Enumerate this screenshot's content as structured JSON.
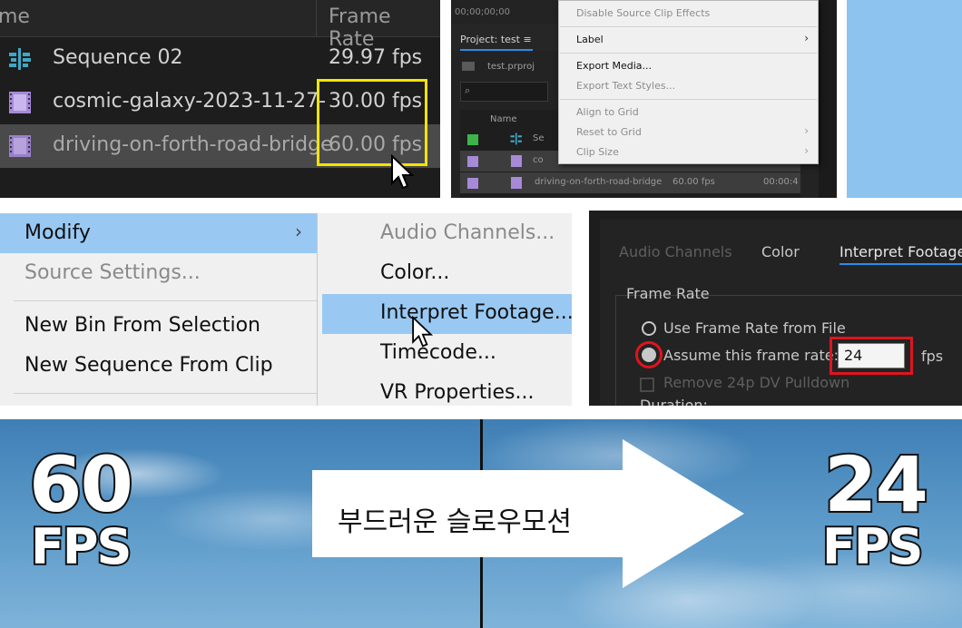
{
  "panel1": {
    "header": {
      "name_col": "me",
      "framerate_col": "Frame Rate"
    },
    "rows": [
      {
        "name": "Sequence 02",
        "fps": "29.97 fps",
        "type": "sequence"
      },
      {
        "name": "cosmic-galaxy-2023-11-27-",
        "fps": "30.00 fps",
        "type": "clip"
      },
      {
        "name": "driving-on-forth-road-bridge",
        "fps": "60.00 fps",
        "type": "clip"
      }
    ],
    "colors": {
      "highlight": "#f4e400",
      "clip_icon": "#a68ad8",
      "sequence_icon": "#3fa8c4"
    }
  },
  "panel2": {
    "timecode": "00;00;00;00",
    "project_tab": "Project: test",
    "tab_menu_glyph": "≡",
    "project_file": "test.prproj",
    "search_glyph": "⌕",
    "col_name": "Name",
    "rows": [
      {
        "name": "Se",
        "fps": "",
        "dur": ""
      },
      {
        "name": "co",
        "fps": "",
        "dur": ""
      },
      {
        "name": "driving-on-forth-road-bridge",
        "fps": "60.00 fps",
        "dur": "00:00:4"
      }
    ],
    "menu": {
      "disable_effects": "Disable Source Clip Effects",
      "label": "Label",
      "export_media": "Export Media...",
      "export_text_styles": "Export Text Styles...",
      "align_to_grid": "Align to Grid",
      "reset_to_grid": "Reset to Grid",
      "clip_size": "Clip Size",
      "arrow": "›"
    }
  },
  "panel4": {
    "left": {
      "modify": "Modify",
      "modify_arrow": "›",
      "source_settings": "Source Settings...",
      "new_bin": "New Bin From Selection",
      "new_sequence": "New Sequence From Clip"
    },
    "right": {
      "audio_channels": "Audio Channels...",
      "color": "Color...",
      "interpret_footage": "Interpret Footage...",
      "timecode": "Timecode...",
      "vr_properties": "VR Properties..."
    }
  },
  "panel5": {
    "tabs": [
      "Audio Channels",
      "Color",
      "Interpret Footage"
    ],
    "section": "Frame Rate",
    "use_file": "Use Frame Rate from File",
    "assume": "Assume this frame rate:",
    "rate_value": "24",
    "unit": "fps",
    "remove_pulldown": "Remove 24p DV Pulldown",
    "duration": "Duration:",
    "colors": {
      "annotation": "#e0141e",
      "tab_active": "#2d8ceb"
    }
  },
  "panel6": {
    "left_num": "60",
    "left_unit": "FPS",
    "arrow_text": "부드러운 슬로우모션",
    "right_num": "24",
    "right_unit": "FPS"
  }
}
